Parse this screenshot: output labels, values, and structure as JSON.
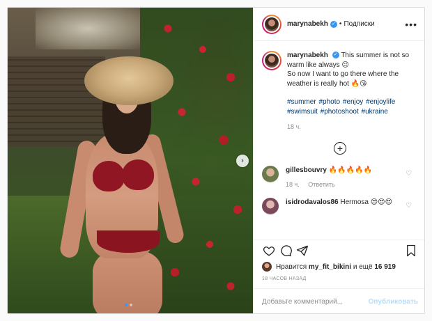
{
  "post": {
    "username": "marynabekh",
    "follow_separator": "•",
    "follow_label": "Подписки",
    "more_label": "•••",
    "caption": {
      "username": "marynabekh",
      "line1": "This summer is not so warm like always 😉",
      "line2": "So now I want to go there where the weather is really hot 🔥😘",
      "hashtags": "#summer #photo #enjoy #enjoylife #swimsuit #photoshoot #ukraine",
      "time": "18 ч."
    },
    "load_more_label": "+",
    "comments": [
      {
        "username": "gillesbouvry",
        "text": "🔥🔥🔥🔥🔥",
        "time": "18 ч.",
        "reply": "Ответить"
      },
      {
        "username": "isidrodavalos86",
        "text": "Hermosa 😍😍😍",
        "time": "",
        "reply": ""
      }
    ],
    "likes": {
      "prefix": "Нравится",
      "user": "my_fit_bikini",
      "middle": "и ещё",
      "count": "16 919"
    },
    "date": "18 ЧАСОВ НАЗАД",
    "comment_placeholder": "Добавьте комментарий...",
    "publish_label": "Опубликовать",
    "carousel": {
      "slides": 2,
      "active_index": 0
    }
  },
  "icons": [
    "verified-badge-icon",
    "heart-icon",
    "comment-icon",
    "share-icon",
    "bookmark-icon",
    "next-arrow-icon",
    "plus-circle-icon"
  ],
  "colors": {
    "link": "#00376b",
    "accent": "#3897f0",
    "muted": "#8e8e8e",
    "publish_disabled": "#b2dffc"
  }
}
